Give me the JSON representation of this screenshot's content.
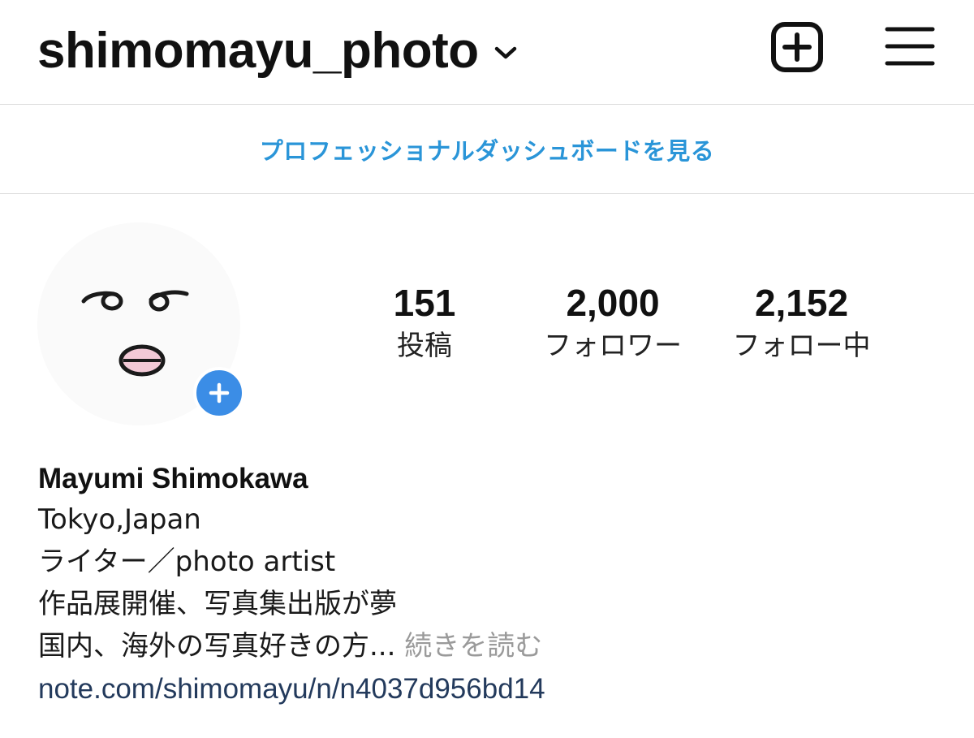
{
  "header": {
    "username": "shimomayu_photo",
    "chevron_icon": "chevron-down-icon",
    "new_post_icon": "plus-square-icon",
    "menu_icon": "hamburger-menu-icon"
  },
  "dashboard": {
    "link_label": "プロフェッショナルダッシュボードを見る",
    "link_color": "#2a95d8"
  },
  "profile": {
    "avatar_icon": "face-doodle-avatar",
    "add_story_icon": "plus-icon",
    "add_story_color": "#3b8de6",
    "stats": {
      "posts": {
        "count": "151",
        "label": "投稿"
      },
      "followers": {
        "count": "2,000",
        "label": "フォロワー"
      },
      "following": {
        "count": "2,152",
        "label": "フォロー中"
      }
    }
  },
  "bio": {
    "full_name": "Mayumi Shimokawa",
    "lines": [
      "Tokyo,Japan",
      "ライター／photo artist",
      "作品展開催、写真集出版が夢"
    ],
    "truncated_line": "国内、海外の写真好きの方...",
    "more_label": "続きを読む",
    "link": "note.com/shimomayu/n/n4037d956bd14",
    "link_color": "#233a5c"
  }
}
